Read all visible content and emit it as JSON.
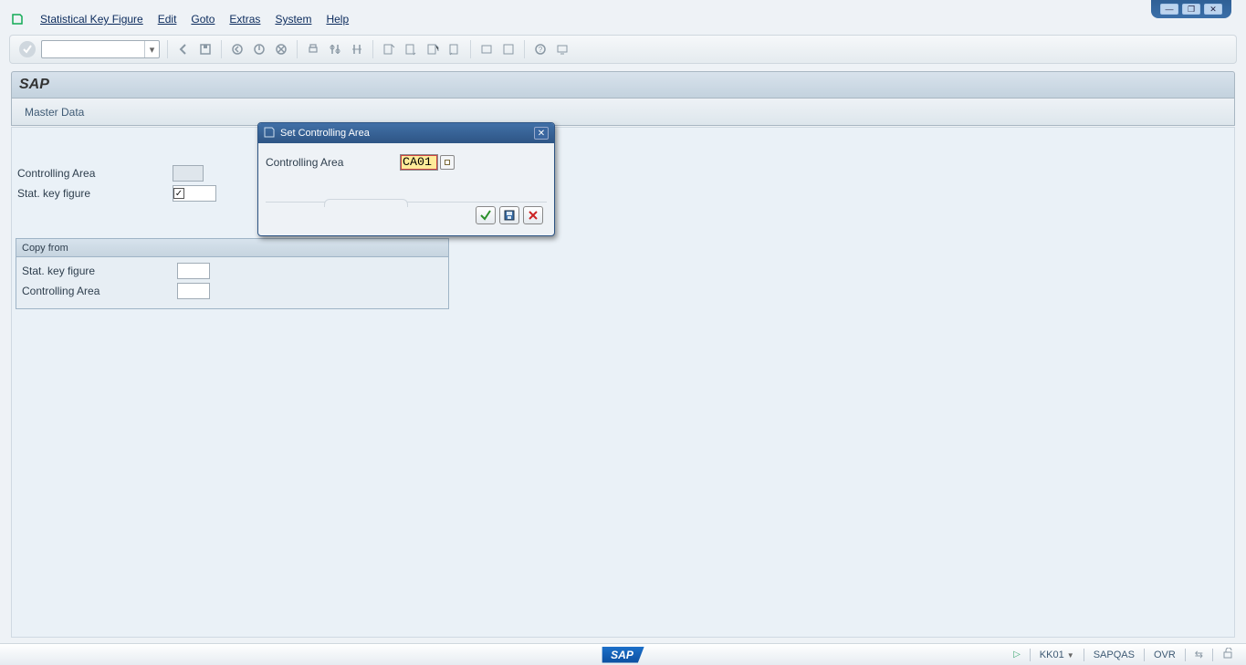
{
  "menus": {
    "stat_key_figure": "Statistical Key Figure",
    "edit": "Edit",
    "goto": "Goto",
    "extras": "Extras",
    "system": "System",
    "help": "Help"
  },
  "toolbar": {
    "command": ""
  },
  "title": "SAP",
  "subheader": {
    "button": "Master Data"
  },
  "form": {
    "controlling_area_label": "Controlling Area",
    "controlling_area_value": "",
    "stat_key_figure_label": "Stat. key figure",
    "stat_key_figure_value": "",
    "checkbox_checked": true
  },
  "groupbox": {
    "title": "Copy from",
    "stat_key_figure_label": "Stat. key figure",
    "stat_key_figure_value": "",
    "controlling_area_label": "Controlling Area",
    "controlling_area_value": ""
  },
  "dialog": {
    "title": "Set Controlling Area",
    "controlling_area_label": "Controlling Area",
    "controlling_area_value": "CA01"
  },
  "status": {
    "tcode": "KK01",
    "system": "SAPQAS",
    "mode": "OVR"
  },
  "icons": {
    "check": "✔",
    "floppy": "💾",
    "cancel": "✖"
  }
}
